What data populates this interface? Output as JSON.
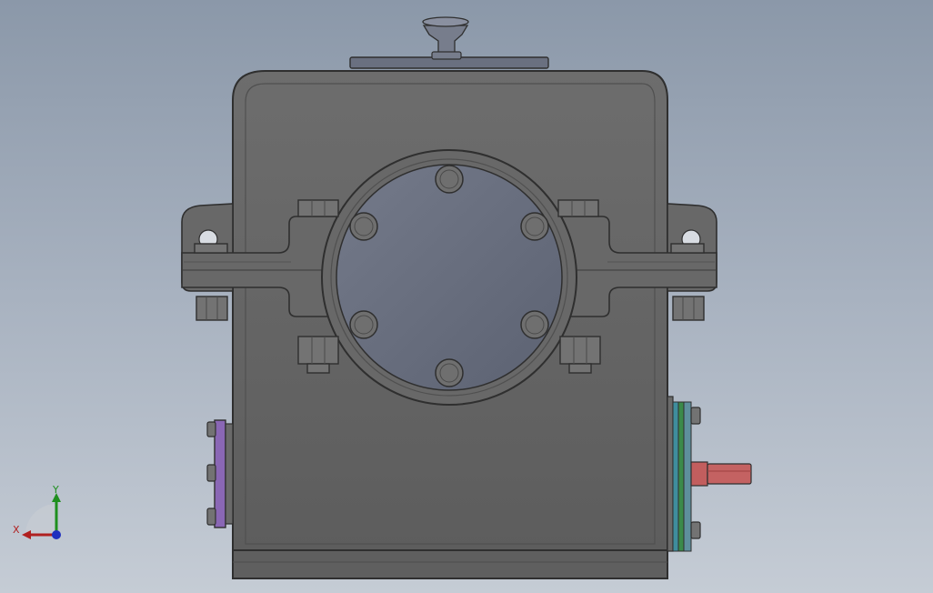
{
  "viewport": {
    "background_top": "#8b98a9",
    "background_bottom": "#c5ccd5"
  },
  "model": {
    "housing_color": "#656565",
    "outline_color": "#2f2f2f",
    "cover_color": "#6a7080",
    "input_flange_color": "#8a67b5",
    "output_flange_color": "#3f8d9d",
    "output_shaft_color": "#c25e5e"
  },
  "triad": {
    "x_label": "X",
    "y_label": "Y",
    "x_color": "#b02020",
    "y_color": "#1f8f1f",
    "z_color": "#1f2fbf"
  }
}
